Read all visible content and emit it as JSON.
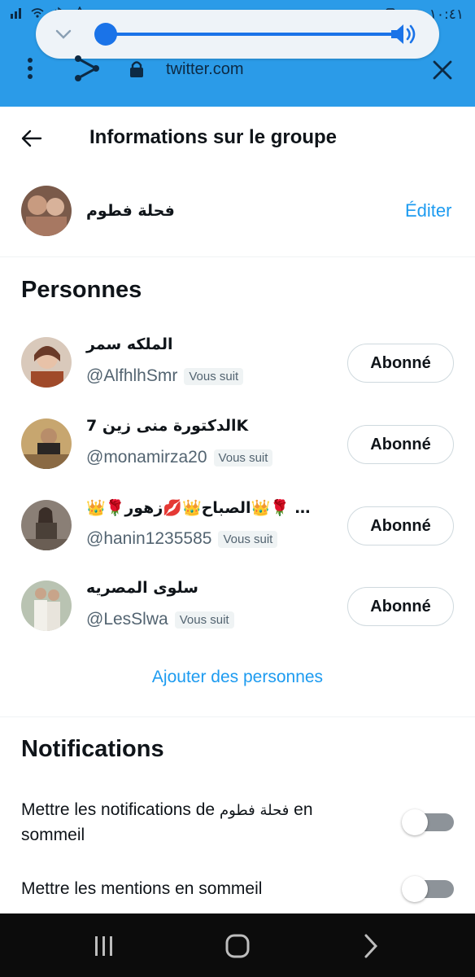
{
  "status_bar": {
    "time": "١٠:٤١"
  },
  "browser": {
    "url": "twitter.com"
  },
  "page": {
    "title": "Informations sur le groupe"
  },
  "group": {
    "name": "فحلة فطوم",
    "edit_label": "Éditer"
  },
  "people_section": {
    "title": "Personnes",
    "members": [
      {
        "name": "الملكه سمر",
        "handle": "@AlfhlhSmr",
        "badge": "Vous suit",
        "button": "Abonné"
      },
      {
        "name": "الدكتورة منى زين 7K",
        "handle": "@monamirza20",
        "badge": "Vous suit",
        "button": "Abonné"
      },
      {
        "name": "👑🌹الصباح👑💋زهور👑🌹 …",
        "handle": "@hanin1235585",
        "badge": "Vous suit",
        "button": "Abonné"
      },
      {
        "name": "سلوى المصريه",
        "handle": "@LesSlwa",
        "badge": "Vous suit",
        "button": "Abonné"
      }
    ],
    "add_label": "Ajouter des personnes"
  },
  "notifications_section": {
    "title": "Notifications",
    "snooze_group_label_before": "Mettre les notifications de ",
    "snooze_group_label_name": "فحلة فطوم",
    "snooze_group_label_after": " en sommeil",
    "snooze_mentions_label": "Mettre les mentions en sommeil",
    "snooze_group_on": false,
    "snooze_mentions_on": false
  },
  "colors": {
    "browser_bar": "#2b9be8",
    "accent": "#1d9bf0",
    "slider": "#1a73e8"
  },
  "media_volume": 0.0
}
